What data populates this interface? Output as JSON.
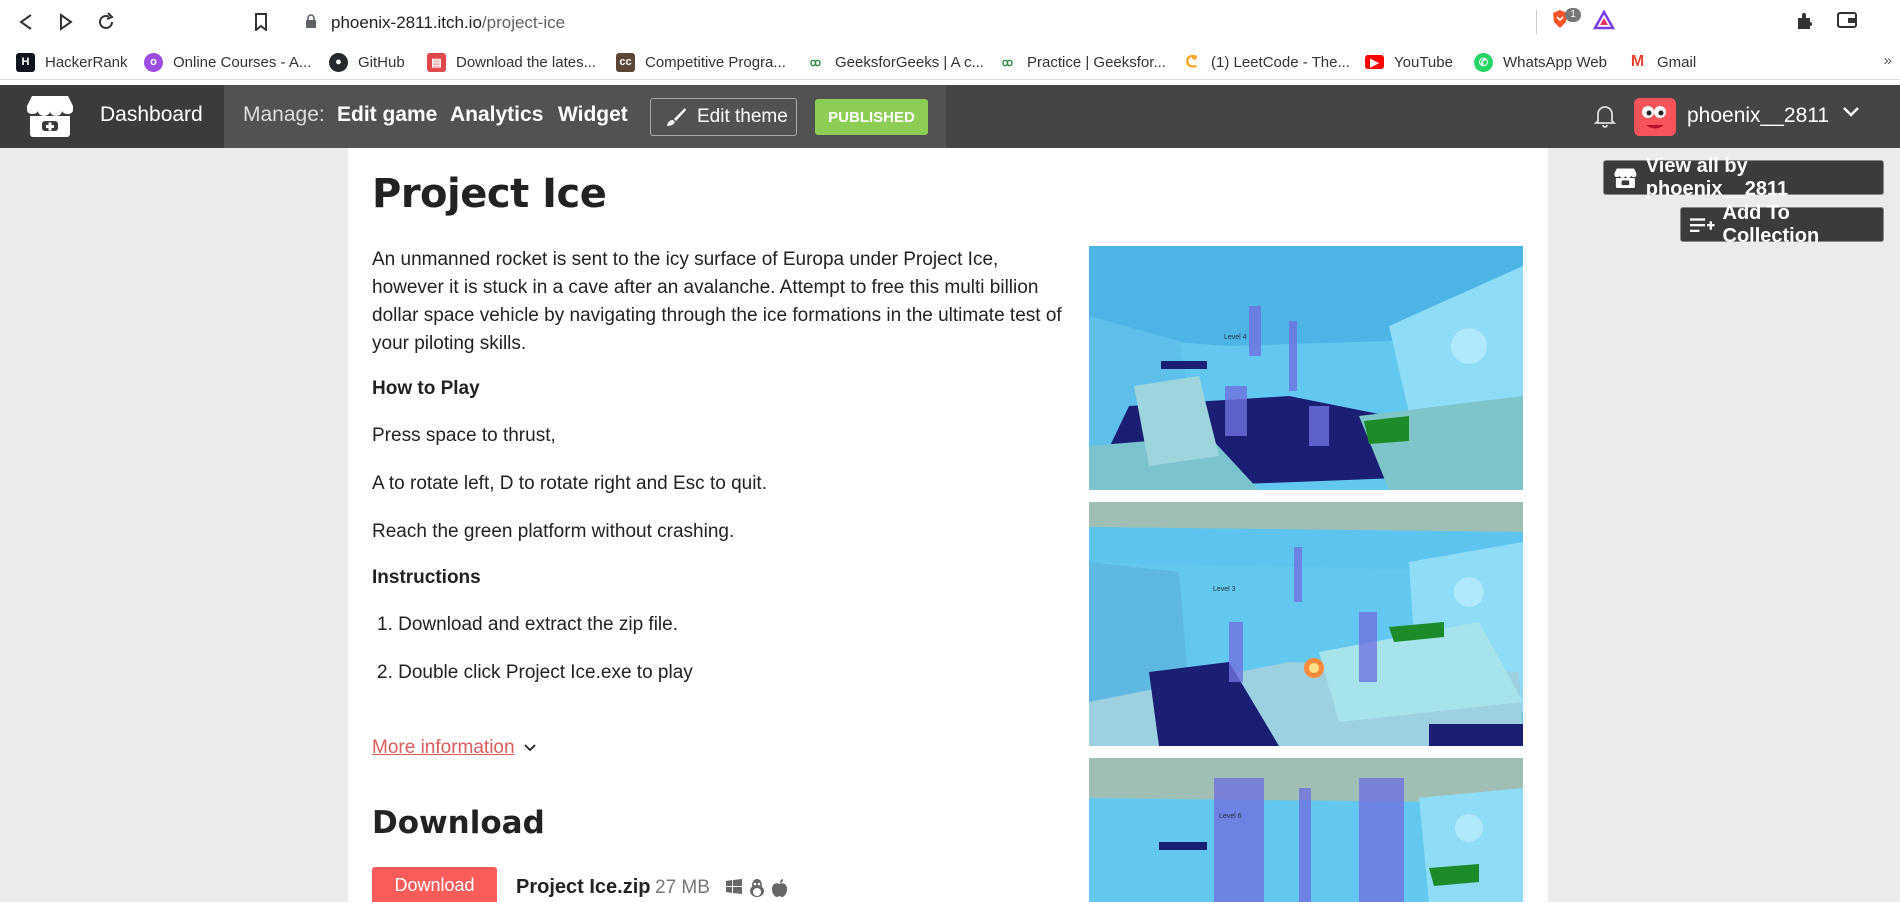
{
  "browser": {
    "url_host": "phoenix-2811.itch.io",
    "url_path": "/project-ice",
    "brave_badge_count": "1"
  },
  "bookmarks": [
    {
      "label": "HackerRank",
      "icon": "hackerrank-icon",
      "color": "#1ba94c"
    },
    {
      "label": "Online Courses - A...",
      "icon": "online-courses-icon",
      "color": "#9b4de0"
    },
    {
      "label": "GitHub",
      "icon": "github-icon",
      "color": "#24292e"
    },
    {
      "label": "Download the lates...",
      "icon": "download-icon",
      "color": "#e0474c"
    },
    {
      "label": "Competitive Progra...",
      "icon": "codechef-icon",
      "color": "#5b4638"
    },
    {
      "label": "GeeksforGeeks | A c...",
      "icon": "gfg-icon",
      "color": "#2f8d46"
    },
    {
      "label": "Practice | Geeksfor...",
      "icon": "gfg-icon",
      "color": "#2f8d46"
    },
    {
      "label": "(1) LeetCode - The...",
      "icon": "leetcode-icon",
      "color": "#ffa116"
    },
    {
      "label": "YouTube",
      "icon": "youtube-icon",
      "color": "#ff0000"
    },
    {
      "label": "WhatsApp Web",
      "icon": "whatsapp-icon",
      "color": "#25d366"
    },
    {
      "label": "Gmail",
      "icon": "gmail-icon",
      "color": "#ea4335"
    }
  ],
  "header": {
    "dashboard": "Dashboard",
    "manage_label": "Manage:",
    "edit_game": "Edit game",
    "analytics": "Analytics",
    "widget": "Widget",
    "edit_theme": "Edit theme",
    "published": "PUBLISHED",
    "username": "phoenix__2811"
  },
  "game": {
    "title": "Project Ice",
    "description": "An unmanned rocket is sent to the icy surface of Europa under Project Ice, however it is stuck in a cave after an avalanche. Attempt to free this multi billion dollar space vehicle by navigating through the ice formations in the ultimate test of your piloting skills.",
    "how_to_play_heading": "How to Play",
    "how_lines": [
      "Press space to thrust,",
      "A to rotate left, D to rotate right and Esc to quit.",
      "Reach the green platform without crashing."
    ],
    "instructions_heading": "Instructions",
    "instructions": [
      "1. Download and extract the zip file.",
      "2. Double click Project Ice.exe to play"
    ],
    "more_information": "More information",
    "download_heading": "Download",
    "download_button": "Download",
    "file_name": "Project Ice.zip",
    "file_size": "27 MB",
    "screenshot_labels": [
      "Level 4",
      "Level 3",
      "Level 6"
    ]
  },
  "side": {
    "view_all": "View all by phoenix__2811",
    "add_to_collection": "Add To Collection"
  },
  "colors": {
    "header_bg": "#454545",
    "published": "#8ccd55",
    "accent": "#fa5c5c",
    "link": "#da5c5c"
  }
}
